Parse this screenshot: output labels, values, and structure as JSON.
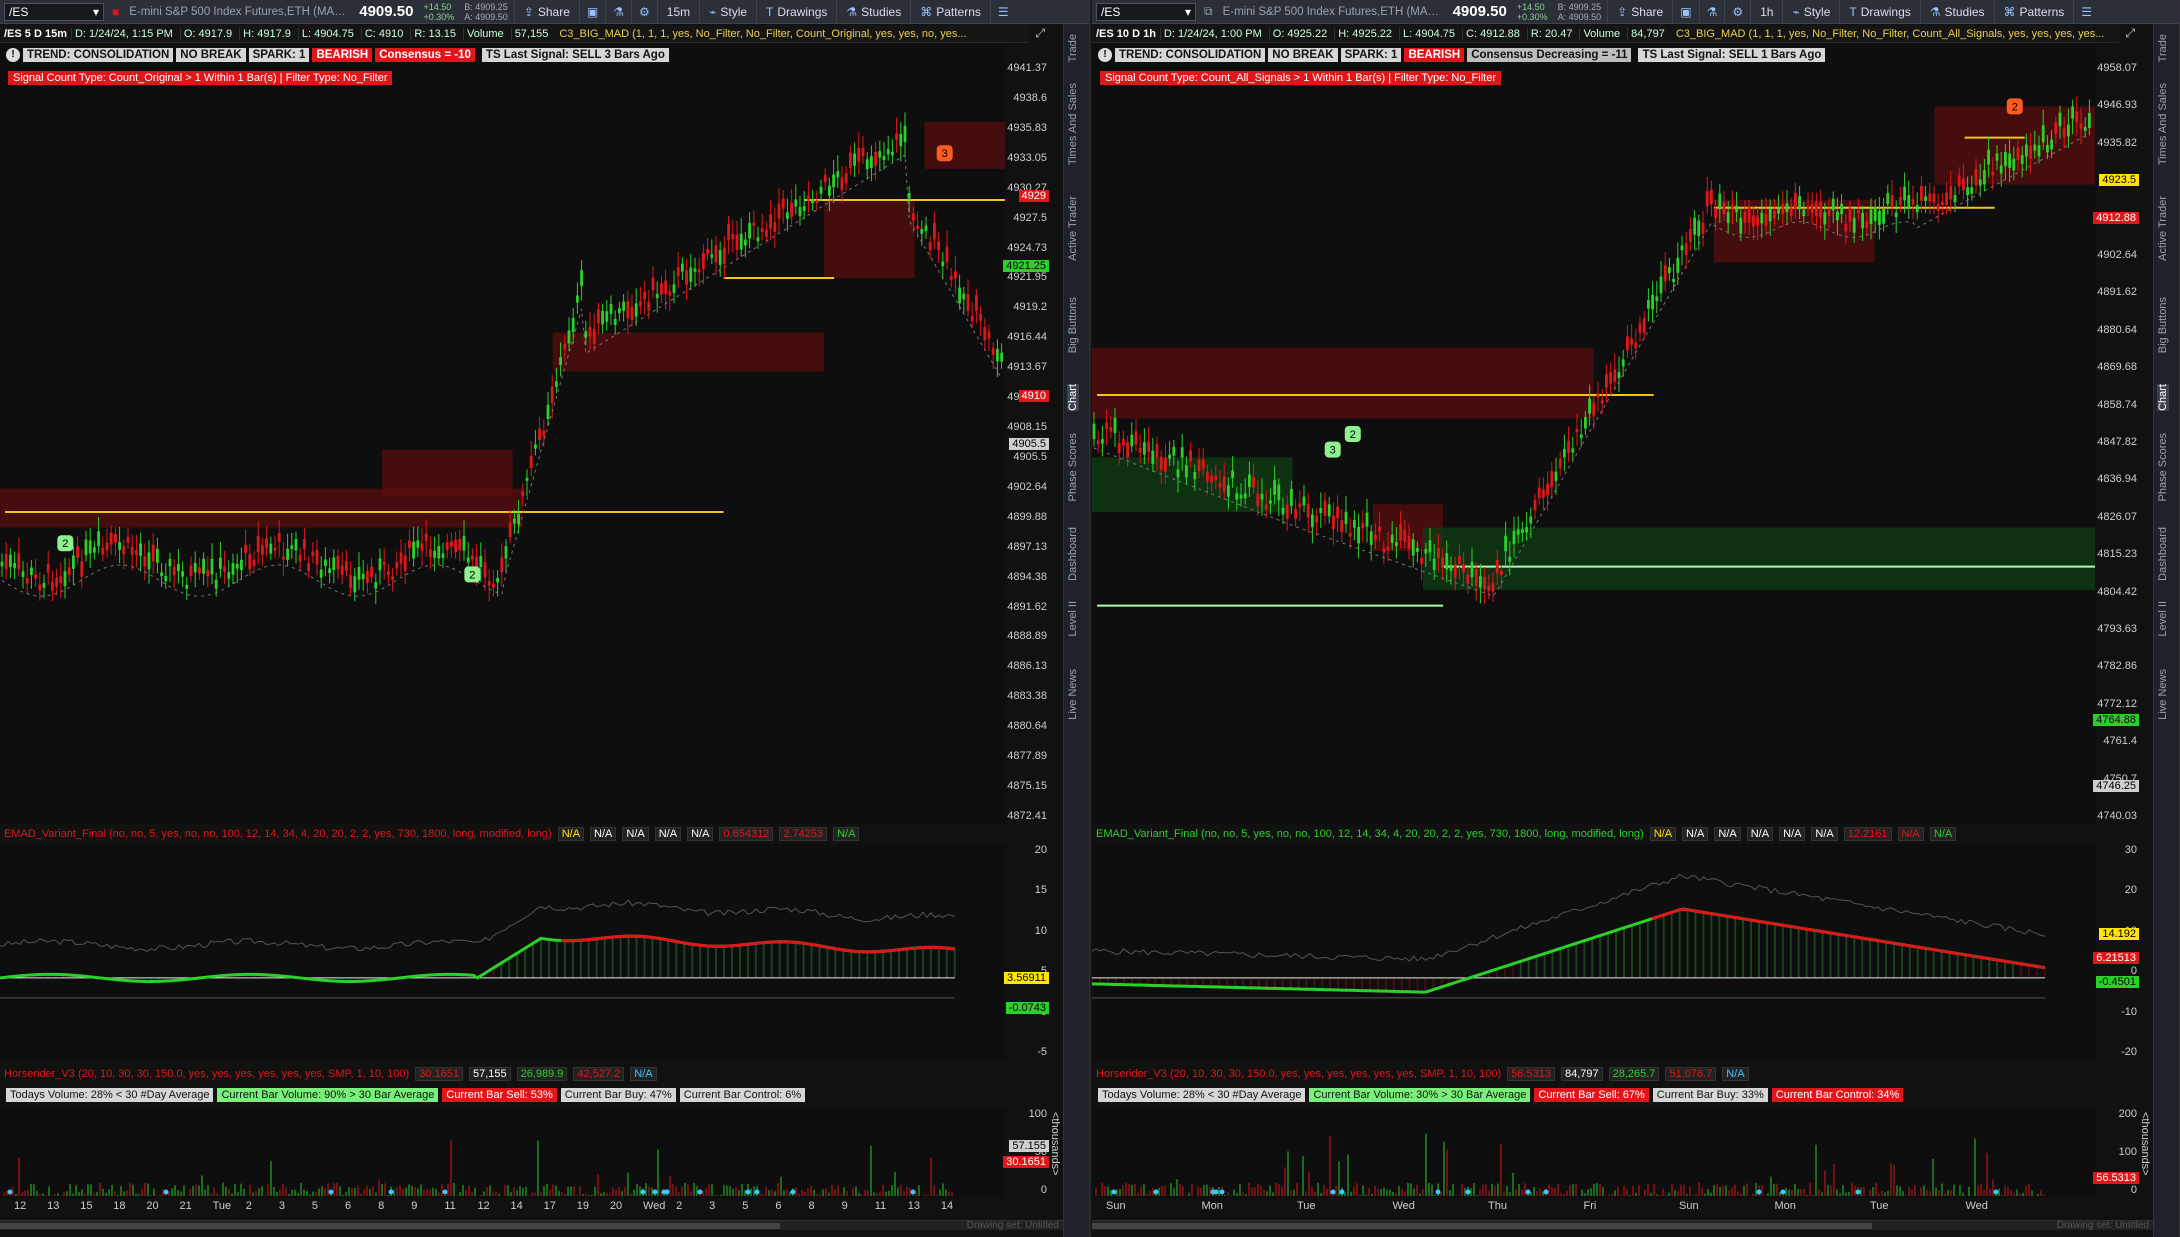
{
  "panels": [
    {
      "toolbar": {
        "symbol": "/ES",
        "description": "E-mini S&P 500 Index Futures,ETH (MAR...",
        "price": "4909.50",
        "change_abs": "+14.50",
        "change_pct": "+0.30%",
        "bid": "B: 4909.25",
        "ask": "A: 4909.50",
        "share_label": "Share",
        "timeframe": "15m",
        "style_label": "Style",
        "drawings_label": "Drawings",
        "studies_label": "Studies",
        "patterns_label": "Patterns"
      },
      "infobar": {
        "symbol": "/ES 5 D 15m",
        "date": "D: 1/24/24, 1:15 PM",
        "open": "O: 4917.9",
        "high": "H: 4917.9",
        "low": "L: 4904.75",
        "close": "C: 4910",
        "range": "R: 13.15",
        "volume_label": "Volume",
        "volume": "57,155",
        "study": "C3_BIG_MAD (1, 1, 1, yes, No_Filter, No_Filter, Count_Original, yes, yes, no, yes..."
      },
      "tags": [
        "TREND: CONSOLIDATION",
        "NO BREAK",
        "SPARK: 1",
        "BEARISH",
        "Consensus = -10"
      ],
      "ts_signal": "TS Last Signal: SELL 3 Bars Ago",
      "signal_count": "Signal Count Type: Count_Original > 1 Within 1 Bar(s) | Filter Type: No_Filter",
      "price_axis": [
        "4941.37",
        "4938.6",
        "4935.83",
        "4933.05",
        "4930.27",
        "4927.5",
        "4924.73",
        "4921.95",
        "4919.2",
        "4916.44",
        "4913.67",
        "4910.91",
        "4908.15",
        "4905.5",
        "4902.64",
        "4899.88",
        "4897.13",
        "4894.38",
        "4891.62",
        "4888.89",
        "4886.13",
        "4883.38",
        "4880.64",
        "4877.89",
        "4875.15",
        "4872.41"
      ],
      "price_badges": [
        {
          "label": "4929",
          "kind": "red"
        },
        {
          "label": "4921.25",
          "kind": "green"
        },
        {
          "label": "4910",
          "kind": "red"
        },
        {
          "label": "4905.5",
          "kind": "gray"
        }
      ],
      "emad": {
        "name": "EMAD_Variant_Final (no, no, 5, yes, no, no, 100, 12, 14, 34, 4, 20, 20, 2, 2, yes, 730, 1800, long, modified, long)",
        "values": [
          "N/A",
          "N/A",
          "N/A",
          "N/A",
          "N/A",
          "0.654312",
          "2.74253",
          "N/A"
        ],
        "axis": [
          "20",
          "15",
          "10",
          "5",
          "0",
          "-5"
        ],
        "badges": [
          {
            "label": "3.56911",
            "kind": "yellow"
          },
          {
            "label": "-0.0743",
            "kind": "green"
          }
        ]
      },
      "horserider": {
        "name": "Horserider_V3 (20, 10, 30, 30, 150.0, yes, yes, yes, yes, yes, yes, SMP, 1, 10, 100)",
        "values": [
          "30.1651",
          "57,155",
          "26,989.9",
          "42,527.2",
          "N/A"
        ]
      },
      "vol_tags": [
        "Todays Volume: 28% < 30 #Day Average",
        "Current Bar Volume: 90% > 30 Bar Average",
        "Current Bar Sell: 53%",
        "Current Bar Buy: 47%",
        "Current Bar Control: 6%"
      ],
      "vol_axis": [
        "100",
        "50",
        "0"
      ],
      "vol_badges": [
        {
          "label": "57.155",
          "kind": "gray"
        },
        {
          "label": "30.1651",
          "kind": "red"
        }
      ],
      "vol_unit": "<thousands>",
      "x_axis": [
        "12",
        "13",
        "15",
        "18",
        "20",
        "21",
        "Tue",
        "2",
        "3",
        "5",
        "6",
        "8",
        "9",
        "11",
        "12",
        "14",
        "17",
        "19",
        "20",
        "Wed",
        "2",
        "3",
        "5",
        "6",
        "8",
        "9",
        "11",
        "13",
        "14"
      ],
      "footer_note": "Drawing set: Untitled"
    },
    {
      "toolbar": {
        "symbol": "/ES",
        "description": "E-mini S&P 500 Index Futures,ETH (MAR...",
        "price": "4909.50",
        "change_abs": "+14.50",
        "change_pct": "+0.30%",
        "bid": "B: 4909.25",
        "ask": "A: 4909.50",
        "share_label": "Share",
        "timeframe": "1h",
        "style_label": "Style",
        "drawings_label": "Drawings",
        "studies_label": "Studies",
        "patterns_label": "Patterns"
      },
      "infobar": {
        "symbol": "/ES 10 D 1h",
        "date": "D: 1/24/24, 1:00 PM",
        "open": "O: 4925.22",
        "high": "H: 4925.22",
        "low": "L: 4904.75",
        "close": "C: 4912.88",
        "range": "R: 20.47",
        "volume_label": "Volume",
        "volume": "84,797",
        "study": "C3_BIG_MAD (1, 1, 1, yes, No_Filter, No_Filter, Count_All_Signals, yes, yes, yes, yes..."
      },
      "tags": [
        "TREND: CONSOLIDATION",
        "NO BREAK",
        "SPARK: 1",
        "BEARISH",
        "Consensus Decreasing = -11"
      ],
      "ts_signal": "TS Last Signal: SELL 1 Bars Ago",
      "signal_count": "Signal Count Type: Count_All_Signals > 1 Within 1 Bar(s) | Filter Type: No_Filter",
      "price_axis": [
        "4958.07",
        "4946.93",
        "4935.82",
        "4924.7",
        "4913.58",
        "4902.64",
        "4891.62",
        "4880.64",
        "4869.68",
        "4858.74",
        "4847.82",
        "4836.94",
        "4826.07",
        "4815.23",
        "4804.42",
        "4793.63",
        "4782.86",
        "4772.12",
        "4761.4",
        "4750.7",
        "4740.03"
      ],
      "price_badges": [
        {
          "label": "4923.5",
          "kind": "yellow"
        },
        {
          "label": "4912.88",
          "kind": "red"
        },
        {
          "label": "4764.88",
          "kind": "green"
        },
        {
          "label": "4746.25",
          "kind": "gray"
        }
      ],
      "emad": {
        "name": "EMAD_Variant_Final (no, no, 5, yes, no, no, 100, 12, 14, 34, 4, 20, 20, 2, 2, yes, 730, 1800, long, modified, long)",
        "values": [
          "N/A",
          "N/A",
          "N/A",
          "N/A",
          "N/A",
          "N/A",
          "12.2161",
          "N/A",
          "N/A"
        ],
        "axis": [
          "30",
          "20",
          "10",
          "0",
          "-10",
          "-20"
        ],
        "badges": [
          {
            "label": "14.192",
            "kind": "yellow"
          },
          {
            "label": "6.21513",
            "kind": "red"
          },
          {
            "label": "-0.4501",
            "kind": "green"
          }
        ]
      },
      "horserider": {
        "name": "Horserider_V3 (20, 10, 30, 30, 150.0, yes, yes, yes, yes, yes, yes, SMP, 1, 10, 100)",
        "values": [
          "56.5313",
          "84,797",
          "28,265.7",
          "51,076.7",
          "N/A"
        ]
      },
      "vol_tags": [
        "Todays Volume: 28% < 30 #Day Average",
        "Current Bar Volume: 30% > 30 Bar Average",
        "Current Bar Sell: 67%",
        "Current Bar Buy: 33%",
        "Current Bar Control: 34%"
      ],
      "vol_axis": [
        "200",
        "100",
        "0"
      ],
      "vol_badges": [
        {
          "label": "56.5313",
          "kind": "red"
        }
      ],
      "vol_unit": "<thousands>",
      "x_axis": [
        "Sun",
        "Mon",
        "Tue",
        "Wed",
        "Thu",
        "Fri",
        "Sun",
        "Mon",
        "Tue",
        "Wed"
      ],
      "footer_note": "Drawing set: Untitled"
    }
  ],
  "side_tabs": [
    "Trade",
    "Times And Sales",
    "Active Trader",
    "Big Buttons",
    "Chart",
    "Phase Scores",
    "Dashboard",
    "Level II",
    "Live News"
  ],
  "colors": {
    "bull": "#2bd12b",
    "bear": "#e0171a",
    "level": "#f0c419",
    "zone_red": "#5a0e10",
    "zone_green": "#0f3d14"
  }
}
